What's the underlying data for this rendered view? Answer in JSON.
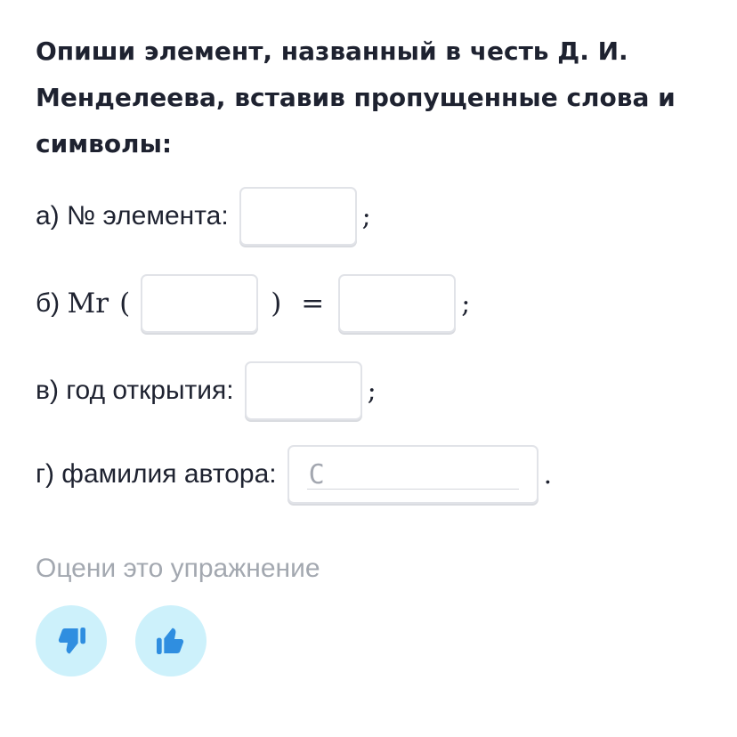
{
  "question": {
    "line1": "Опиши элемент, названный в честь Д. И.",
    "line2": "Менделеева, вставив пропущенные слова и",
    "line3": "символы:"
  },
  "items": {
    "a": {
      "label": "а) ",
      "main": "№ элемента:",
      "end": ";"
    },
    "b": {
      "label": "б) ",
      "mr": "Mr",
      "open": "(",
      "close": ")",
      "equals": "=",
      "end": ";"
    },
    "c": {
      "label": "в) год открытия:",
      "end": ";"
    },
    "d": {
      "label": "г) фамилия автора:",
      "typed": "С",
      "end": "."
    }
  },
  "rating": {
    "label": "Оцени это упражнение",
    "dislike_icon": "thumbs-down-icon",
    "like_icon": "thumbs-up-icon"
  },
  "colors": {
    "title": "#1e2230",
    "muted": "#a3a8b0",
    "rate_bg": "#cdf1fb",
    "rate_icon": "#2f8ee0",
    "input_border": "#e1e3e8"
  }
}
